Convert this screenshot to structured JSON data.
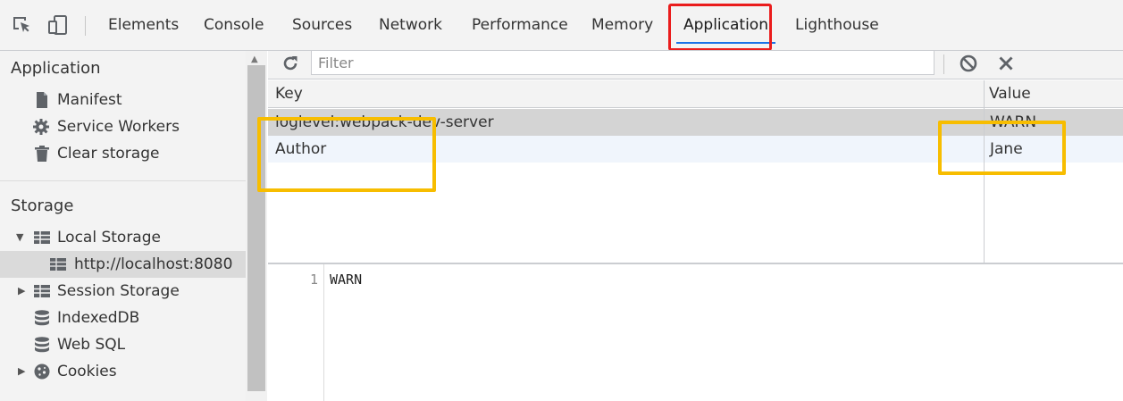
{
  "tabs": [
    "Elements",
    "Console",
    "Sources",
    "Network",
    "Performance",
    "Memory",
    "Application",
    "Lighthouse"
  ],
  "active_tab": "Application",
  "sidebar": {
    "application_title": "Application",
    "application_items": [
      {
        "label": "Manifest",
        "icon": "file-icon"
      },
      {
        "label": "Service Workers",
        "icon": "gear-icon"
      },
      {
        "label": "Clear storage",
        "icon": "trash-icon"
      }
    ],
    "storage_title": "Storage",
    "storage_items": [
      {
        "label": "Local Storage",
        "icon": "table-icon",
        "expanded": true
      },
      {
        "label": "http://localhost:8080",
        "icon": "table-icon",
        "selected": true
      },
      {
        "label": "Session Storage",
        "icon": "table-icon",
        "expanded": false
      },
      {
        "label": "IndexedDB",
        "icon": "database-icon"
      },
      {
        "label": "Web SQL",
        "icon": "database-icon"
      },
      {
        "label": "Cookies",
        "icon": "cookie-icon",
        "expanded": false
      }
    ]
  },
  "toolbar": {
    "filter_placeholder": "Filter",
    "filter_value": ""
  },
  "table": {
    "headers": {
      "key": "Key",
      "value": "Value"
    },
    "rows": [
      {
        "key": "loglevel:webpack-dev-server",
        "value": "WARN",
        "selected": true
      },
      {
        "key": "Author",
        "value": "Jane",
        "selected": false
      }
    ]
  },
  "preview": {
    "line_number": "1",
    "line_text": "WARN"
  },
  "colors": {
    "highlight_red": "#ea1c1c",
    "highlight_yellow": "#f7bd00",
    "active_tab_underline": "#1a73e8"
  }
}
